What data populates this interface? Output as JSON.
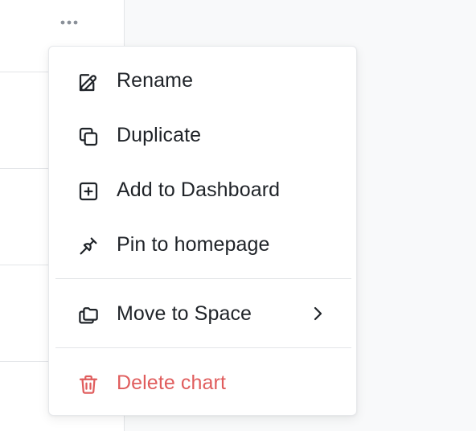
{
  "more_button": {
    "icon": "more-horizontal-icon"
  },
  "menu": {
    "items": [
      {
        "label": "Rename",
        "icon": "pencil-edit-icon"
      },
      {
        "label": "Duplicate",
        "icon": "copy-icon"
      },
      {
        "label": "Add to Dashboard",
        "icon": "plus-square-icon"
      },
      {
        "label": "Pin to homepage",
        "icon": "pin-icon"
      },
      {
        "label": "Move to Space",
        "icon": "folders-icon",
        "submenu_icon": "chevron-right-icon"
      },
      {
        "label": "Delete chart",
        "icon": "trash-icon",
        "color": "#e05d5d"
      }
    ]
  },
  "colors": {
    "text": "#1f2328",
    "danger": "#e05d5d",
    "border": "#e3e5e8",
    "background": "#f8f9fa"
  }
}
